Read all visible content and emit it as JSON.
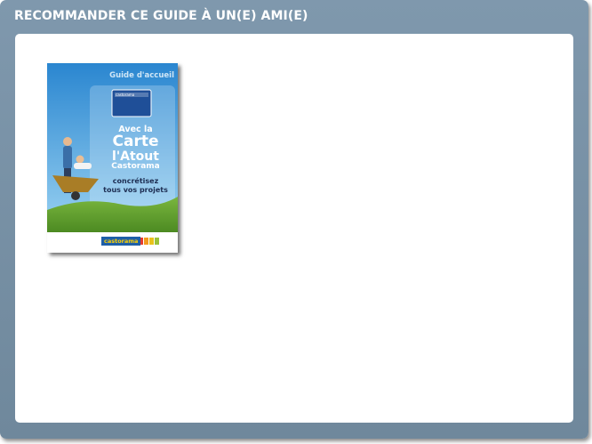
{
  "panel": {
    "title": "RECOMMANDER CE GUIDE À UN(E) AMI(E)"
  },
  "guide_cover": {
    "label": "Guide d'accueil",
    "line1": "Avec la",
    "line2": "Carte",
    "line3": "l'Atout",
    "line4": "Castorama",
    "slogan1": "concrétisez",
    "slogan2": "tous vos projets",
    "card_brand": "castorama",
    "footer_brand": "castorama"
  },
  "colors": {
    "panel": "#7890a4",
    "content": "#ffffff",
    "sky_top": "#2f8fd6",
    "sky_bottom": "#8ccaf0",
    "grass": "#5f9b2c",
    "brand_blue": "#1e5fa8",
    "brand_yellow": "#ffd200"
  }
}
